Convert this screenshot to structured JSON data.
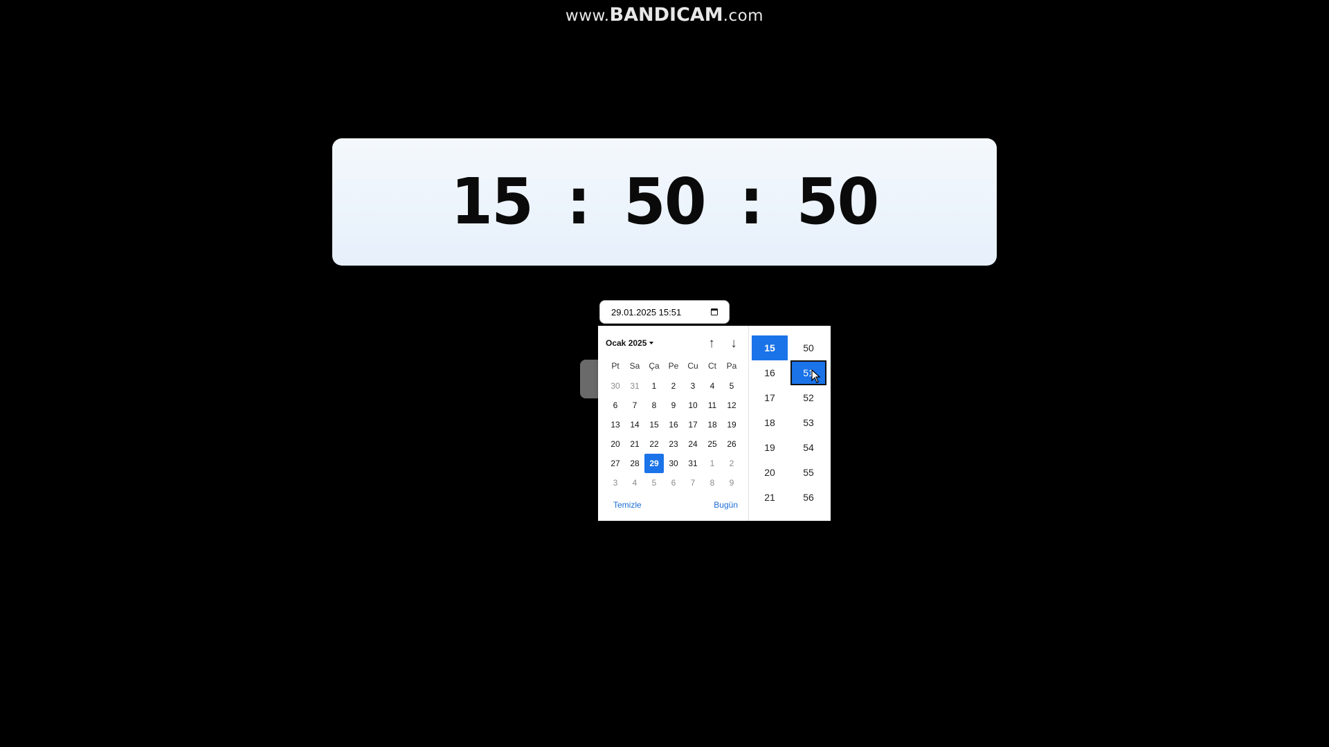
{
  "watermark": {
    "prefix": "www.",
    "brand": "BANDICAM",
    "suffix": ".com"
  },
  "clock": {
    "hours": "15",
    "minutes": "50",
    "seconds": "50",
    "separator": ":"
  },
  "datetime_input": {
    "value": "29.01.2025 15:51",
    "icon": "calendar-icon"
  },
  "calendar": {
    "month_label": "Ocak 2025",
    "weekdays": [
      "Pt",
      "Sa",
      "Ça",
      "Pe",
      "Cu",
      "Ct",
      "Pa"
    ],
    "days": [
      [
        "30",
        "31",
        "1",
        "2",
        "3",
        "4",
        "5"
      ],
      [
        "6",
        "7",
        "8",
        "9",
        "10",
        "11",
        "12"
      ],
      [
        "13",
        "14",
        "15",
        "16",
        "17",
        "18",
        "19"
      ],
      [
        "20",
        "21",
        "22",
        "23",
        "24",
        "25",
        "26"
      ],
      [
        "27",
        "28",
        "29",
        "30",
        "31",
        "1",
        "2"
      ],
      [
        "3",
        "4",
        "5",
        "6",
        "7",
        "8",
        "9"
      ]
    ],
    "selected_day": "29",
    "clear_label": "Temizle",
    "today_label": "Bugün"
  },
  "time_picker": {
    "hours": [
      "15",
      "16",
      "17",
      "18",
      "19",
      "20",
      "21"
    ],
    "minutes": [
      "50",
      "51",
      "52",
      "53",
      "54",
      "55",
      "56"
    ],
    "selected_hour": "15",
    "selected_minute": "51"
  },
  "colors": {
    "accent": "#1a73e8",
    "link": "#1a6bd4",
    "background": "#000000"
  }
}
